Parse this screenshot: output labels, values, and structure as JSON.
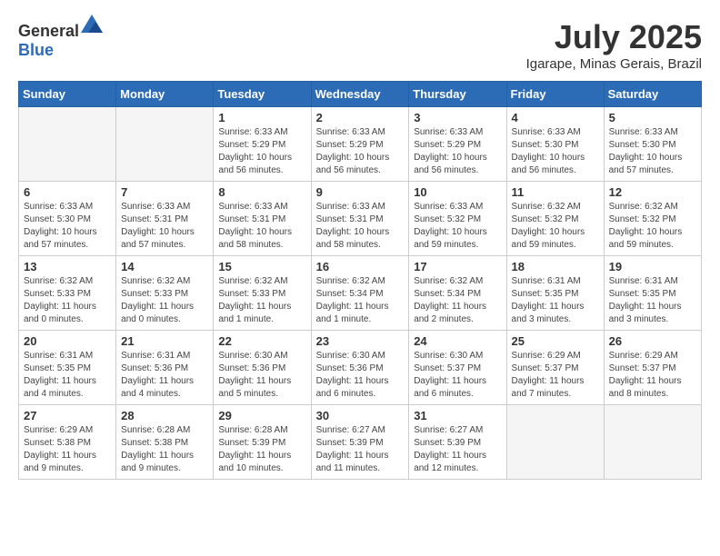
{
  "header": {
    "logo_general": "General",
    "logo_blue": "Blue",
    "month_title": "July 2025",
    "location": "Igarape, Minas Gerais, Brazil"
  },
  "days_of_week": [
    "Sunday",
    "Monday",
    "Tuesday",
    "Wednesday",
    "Thursday",
    "Friday",
    "Saturday"
  ],
  "weeks": [
    [
      {
        "day": "",
        "info": "",
        "empty": true
      },
      {
        "day": "",
        "info": "",
        "empty": true
      },
      {
        "day": "1",
        "info": "Sunrise: 6:33 AM\nSunset: 5:29 PM\nDaylight: 10 hours and 56 minutes."
      },
      {
        "day": "2",
        "info": "Sunrise: 6:33 AM\nSunset: 5:29 PM\nDaylight: 10 hours and 56 minutes."
      },
      {
        "day": "3",
        "info": "Sunrise: 6:33 AM\nSunset: 5:29 PM\nDaylight: 10 hours and 56 minutes."
      },
      {
        "day": "4",
        "info": "Sunrise: 6:33 AM\nSunset: 5:30 PM\nDaylight: 10 hours and 56 minutes."
      },
      {
        "day": "5",
        "info": "Sunrise: 6:33 AM\nSunset: 5:30 PM\nDaylight: 10 hours and 57 minutes."
      }
    ],
    [
      {
        "day": "6",
        "info": "Sunrise: 6:33 AM\nSunset: 5:30 PM\nDaylight: 10 hours and 57 minutes."
      },
      {
        "day": "7",
        "info": "Sunrise: 6:33 AM\nSunset: 5:31 PM\nDaylight: 10 hours and 57 minutes."
      },
      {
        "day": "8",
        "info": "Sunrise: 6:33 AM\nSunset: 5:31 PM\nDaylight: 10 hours and 58 minutes."
      },
      {
        "day": "9",
        "info": "Sunrise: 6:33 AM\nSunset: 5:31 PM\nDaylight: 10 hours and 58 minutes."
      },
      {
        "day": "10",
        "info": "Sunrise: 6:33 AM\nSunset: 5:32 PM\nDaylight: 10 hours and 59 minutes."
      },
      {
        "day": "11",
        "info": "Sunrise: 6:32 AM\nSunset: 5:32 PM\nDaylight: 10 hours and 59 minutes."
      },
      {
        "day": "12",
        "info": "Sunrise: 6:32 AM\nSunset: 5:32 PM\nDaylight: 10 hours and 59 minutes."
      }
    ],
    [
      {
        "day": "13",
        "info": "Sunrise: 6:32 AM\nSunset: 5:33 PM\nDaylight: 11 hours and 0 minutes."
      },
      {
        "day": "14",
        "info": "Sunrise: 6:32 AM\nSunset: 5:33 PM\nDaylight: 11 hours and 0 minutes."
      },
      {
        "day": "15",
        "info": "Sunrise: 6:32 AM\nSunset: 5:33 PM\nDaylight: 11 hours and 1 minute."
      },
      {
        "day": "16",
        "info": "Sunrise: 6:32 AM\nSunset: 5:34 PM\nDaylight: 11 hours and 1 minute."
      },
      {
        "day": "17",
        "info": "Sunrise: 6:32 AM\nSunset: 5:34 PM\nDaylight: 11 hours and 2 minutes."
      },
      {
        "day": "18",
        "info": "Sunrise: 6:31 AM\nSunset: 5:35 PM\nDaylight: 11 hours and 3 minutes."
      },
      {
        "day": "19",
        "info": "Sunrise: 6:31 AM\nSunset: 5:35 PM\nDaylight: 11 hours and 3 minutes."
      }
    ],
    [
      {
        "day": "20",
        "info": "Sunrise: 6:31 AM\nSunset: 5:35 PM\nDaylight: 11 hours and 4 minutes."
      },
      {
        "day": "21",
        "info": "Sunrise: 6:31 AM\nSunset: 5:36 PM\nDaylight: 11 hours and 4 minutes."
      },
      {
        "day": "22",
        "info": "Sunrise: 6:30 AM\nSunset: 5:36 PM\nDaylight: 11 hours and 5 minutes."
      },
      {
        "day": "23",
        "info": "Sunrise: 6:30 AM\nSunset: 5:36 PM\nDaylight: 11 hours and 6 minutes."
      },
      {
        "day": "24",
        "info": "Sunrise: 6:30 AM\nSunset: 5:37 PM\nDaylight: 11 hours and 6 minutes."
      },
      {
        "day": "25",
        "info": "Sunrise: 6:29 AM\nSunset: 5:37 PM\nDaylight: 11 hours and 7 minutes."
      },
      {
        "day": "26",
        "info": "Sunrise: 6:29 AM\nSunset: 5:37 PM\nDaylight: 11 hours and 8 minutes."
      }
    ],
    [
      {
        "day": "27",
        "info": "Sunrise: 6:29 AM\nSunset: 5:38 PM\nDaylight: 11 hours and 9 minutes."
      },
      {
        "day": "28",
        "info": "Sunrise: 6:28 AM\nSunset: 5:38 PM\nDaylight: 11 hours and 9 minutes."
      },
      {
        "day": "29",
        "info": "Sunrise: 6:28 AM\nSunset: 5:39 PM\nDaylight: 11 hours and 10 minutes."
      },
      {
        "day": "30",
        "info": "Sunrise: 6:27 AM\nSunset: 5:39 PM\nDaylight: 11 hours and 11 minutes."
      },
      {
        "day": "31",
        "info": "Sunrise: 6:27 AM\nSunset: 5:39 PM\nDaylight: 11 hours and 12 minutes."
      },
      {
        "day": "",
        "info": "",
        "empty": true
      },
      {
        "day": "",
        "info": "",
        "empty": true
      }
    ]
  ]
}
